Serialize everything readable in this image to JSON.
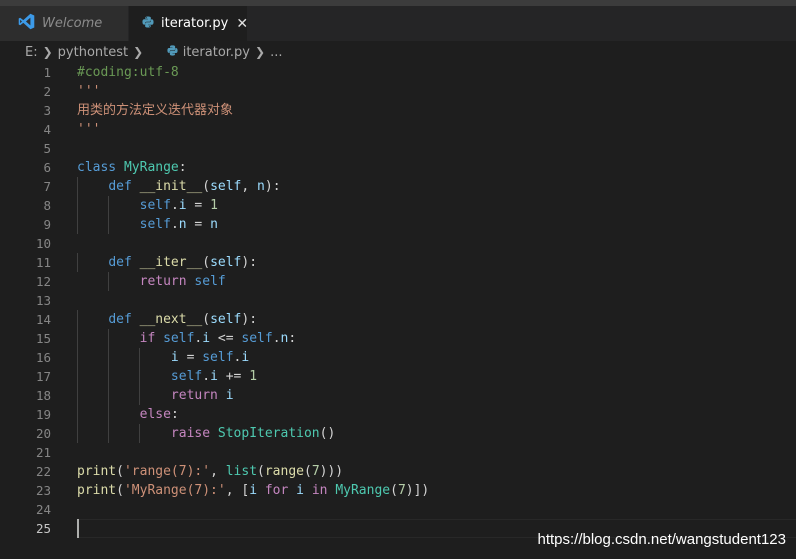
{
  "tabs": [
    {
      "label": "Welcome",
      "icon": "vscode-logo-icon"
    },
    {
      "label": "iterator.py",
      "icon": "python-icon",
      "close": "✕"
    }
  ],
  "breadcrumb": {
    "drive": "E:",
    "folder": "pythontest",
    "file": "iterator.py",
    "more": "..."
  },
  "colors": {
    "background": "#1e1e1e",
    "tab_bar": "#252526",
    "vscode_blue": "#3c9ae8",
    "python_icon": "#519aba",
    "comment": "#6a9955",
    "string": "#ce9178",
    "keyword": "#569cd6",
    "control": "#c586c0",
    "class": "#4ec9b0",
    "function": "#dcdcaa",
    "variable": "#9cdcfe",
    "number": "#b5cea8"
  },
  "editor": {
    "current_line": 25,
    "lines": [
      {
        "n": "1",
        "tokens": [
          [
            "cm",
            "#coding:utf-8"
          ]
        ]
      },
      {
        "n": "2",
        "tokens": [
          [
            "str",
            "'''"
          ]
        ]
      },
      {
        "n": "3",
        "tokens": [
          [
            "str",
            "用类的方法定义迭代器对象"
          ]
        ]
      },
      {
        "n": "4",
        "tokens": [
          [
            "str",
            "'''"
          ]
        ]
      },
      {
        "n": "5",
        "tokens": []
      },
      {
        "n": "6",
        "tokens": [
          [
            "kw",
            "class"
          ],
          [
            "op",
            " "
          ],
          [
            "cls",
            "MyRange"
          ],
          [
            "op",
            ":"
          ]
        ]
      },
      {
        "n": "7",
        "tokens": [
          [
            "op",
            "    "
          ],
          [
            "kw",
            "def"
          ],
          [
            "op",
            " "
          ],
          [
            "fn",
            "__init__"
          ],
          [
            "op",
            "("
          ],
          [
            "var",
            "self"
          ],
          [
            "op",
            ", "
          ],
          [
            "var",
            "n"
          ],
          [
            "op",
            "):"
          ]
        ]
      },
      {
        "n": "8",
        "tokens": [
          [
            "op",
            "        "
          ],
          [
            "kw",
            "self"
          ],
          [
            "op",
            "."
          ],
          [
            "var",
            "i"
          ],
          [
            "op",
            " = "
          ],
          [
            "num",
            "1"
          ]
        ]
      },
      {
        "n": "9",
        "tokens": [
          [
            "op",
            "        "
          ],
          [
            "kw",
            "self"
          ],
          [
            "op",
            "."
          ],
          [
            "var",
            "n"
          ],
          [
            "op",
            " = "
          ],
          [
            "var",
            "n"
          ]
        ]
      },
      {
        "n": "10",
        "tokens": []
      },
      {
        "n": "11",
        "tokens": [
          [
            "op",
            "    "
          ],
          [
            "kw",
            "def"
          ],
          [
            "op",
            " "
          ],
          [
            "fn",
            "__iter__"
          ],
          [
            "op",
            "("
          ],
          [
            "var",
            "self"
          ],
          [
            "op",
            "):"
          ]
        ]
      },
      {
        "n": "12",
        "tokens": [
          [
            "op",
            "        "
          ],
          [
            "ctl",
            "return"
          ],
          [
            "op",
            " "
          ],
          [
            "kw",
            "self"
          ]
        ]
      },
      {
        "n": "13",
        "tokens": []
      },
      {
        "n": "14",
        "tokens": [
          [
            "op",
            "    "
          ],
          [
            "kw",
            "def"
          ],
          [
            "op",
            " "
          ],
          [
            "fn",
            "__next__"
          ],
          [
            "op",
            "("
          ],
          [
            "var",
            "self"
          ],
          [
            "op",
            "):"
          ]
        ]
      },
      {
        "n": "15",
        "tokens": [
          [
            "op",
            "        "
          ],
          [
            "ctl",
            "if"
          ],
          [
            "op",
            " "
          ],
          [
            "kw",
            "self"
          ],
          [
            "op",
            "."
          ],
          [
            "var",
            "i"
          ],
          [
            "op",
            " <= "
          ],
          [
            "kw",
            "self"
          ],
          [
            "op",
            "."
          ],
          [
            "var",
            "n"
          ],
          [
            "op",
            ":"
          ]
        ]
      },
      {
        "n": "16",
        "tokens": [
          [
            "op",
            "            "
          ],
          [
            "var",
            "i"
          ],
          [
            "op",
            " = "
          ],
          [
            "kw",
            "self"
          ],
          [
            "op",
            "."
          ],
          [
            "var",
            "i"
          ]
        ]
      },
      {
        "n": "17",
        "tokens": [
          [
            "op",
            "            "
          ],
          [
            "kw",
            "self"
          ],
          [
            "op",
            "."
          ],
          [
            "var",
            "i"
          ],
          [
            "op",
            " += "
          ],
          [
            "num",
            "1"
          ]
        ]
      },
      {
        "n": "18",
        "tokens": [
          [
            "op",
            "            "
          ],
          [
            "ctl",
            "return"
          ],
          [
            "op",
            " "
          ],
          [
            "var",
            "i"
          ]
        ]
      },
      {
        "n": "19",
        "tokens": [
          [
            "op",
            "        "
          ],
          [
            "ctl",
            "else"
          ],
          [
            "op",
            ":"
          ]
        ]
      },
      {
        "n": "20",
        "tokens": [
          [
            "op",
            "            "
          ],
          [
            "ctl",
            "raise"
          ],
          [
            "op",
            " "
          ],
          [
            "cls",
            "StopIteration"
          ],
          [
            "op",
            "()"
          ]
        ]
      },
      {
        "n": "21",
        "tokens": []
      },
      {
        "n": "22",
        "tokens": [
          [
            "fn",
            "print"
          ],
          [
            "op",
            "("
          ],
          [
            "str",
            "'range(7):'"
          ],
          [
            "op",
            ", "
          ],
          [
            "cls",
            "list"
          ],
          [
            "op",
            "("
          ],
          [
            "fn",
            "range"
          ],
          [
            "op",
            "("
          ],
          [
            "num",
            "7"
          ],
          [
            "op",
            ")))"
          ]
        ]
      },
      {
        "n": "23",
        "tokens": [
          [
            "fn",
            "print"
          ],
          [
            "op",
            "("
          ],
          [
            "str",
            "'MyRange(7):'"
          ],
          [
            "op",
            ", ["
          ],
          [
            "var",
            "i"
          ],
          [
            "op",
            " "
          ],
          [
            "ctl",
            "for"
          ],
          [
            "op",
            " "
          ],
          [
            "var",
            "i"
          ],
          [
            "op",
            " "
          ],
          [
            "ctl",
            "in"
          ],
          [
            "op",
            " "
          ],
          [
            "cls",
            "MyRange"
          ],
          [
            "op",
            "("
          ],
          [
            "num",
            "7"
          ],
          [
            "op",
            ")])"
          ]
        ]
      },
      {
        "n": "24",
        "tokens": []
      },
      {
        "n": "25",
        "tokens": []
      }
    ]
  },
  "watermark": "https://blog.csdn.net/wangstudent123"
}
